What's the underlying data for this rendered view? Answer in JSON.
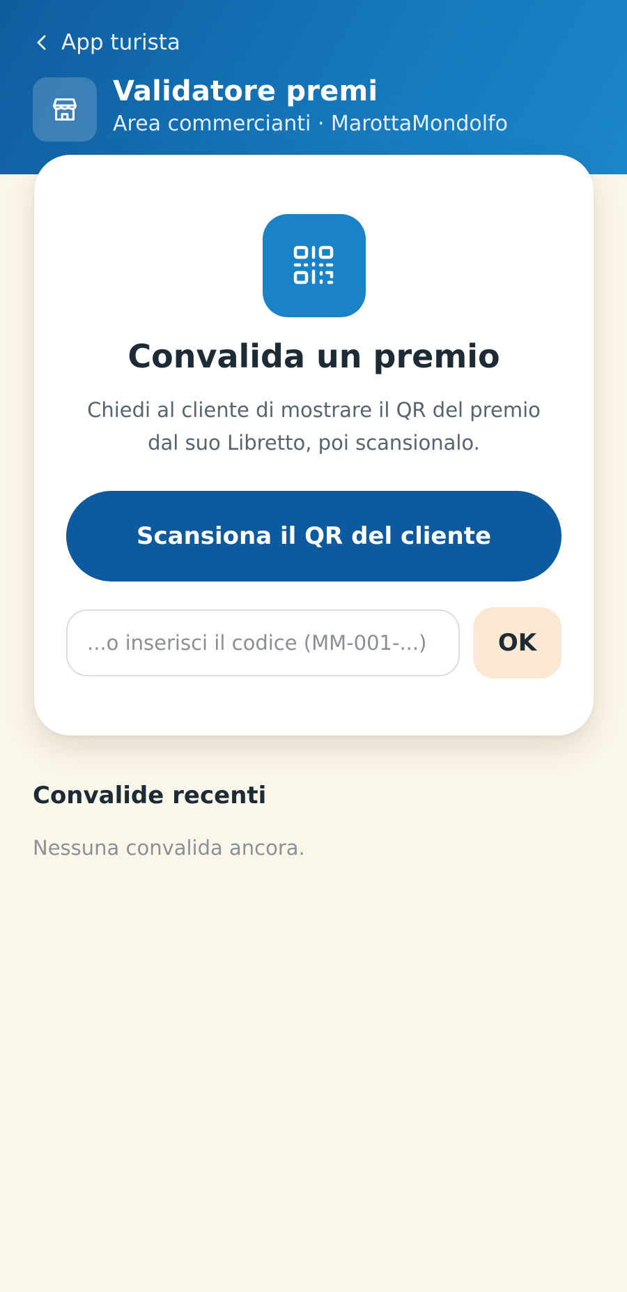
{
  "header": {
    "back_label": "App turista",
    "title": "Validatore premi",
    "subtitle": "Area commercianti · MarottaMondolfo",
    "icon": "store-icon"
  },
  "card": {
    "icon": "qr-code-icon",
    "title": "Convalida un premio",
    "description": "Chiedi al cliente di mostrare il QR del premio dal suo Libretto, poi scansionalo.",
    "scan_button_label": "Scansiona il QR del cliente",
    "code_input": {
      "value": "",
      "placeholder": "...o inserisci il codice (MM-001-...)"
    },
    "ok_button_label": "OK"
  },
  "recent": {
    "title": "Convalide recenti",
    "empty_message": "Nessuna convalida ancora."
  },
  "colors": {
    "header_gradient_start": "#0f5c9e",
    "header_gradient_end": "#1a86c9",
    "primary_button": "#0d5a9e",
    "qr_tile": "#1a82c6",
    "ok_button": "#fbe8d3",
    "page_background": "#fbf6ea"
  }
}
